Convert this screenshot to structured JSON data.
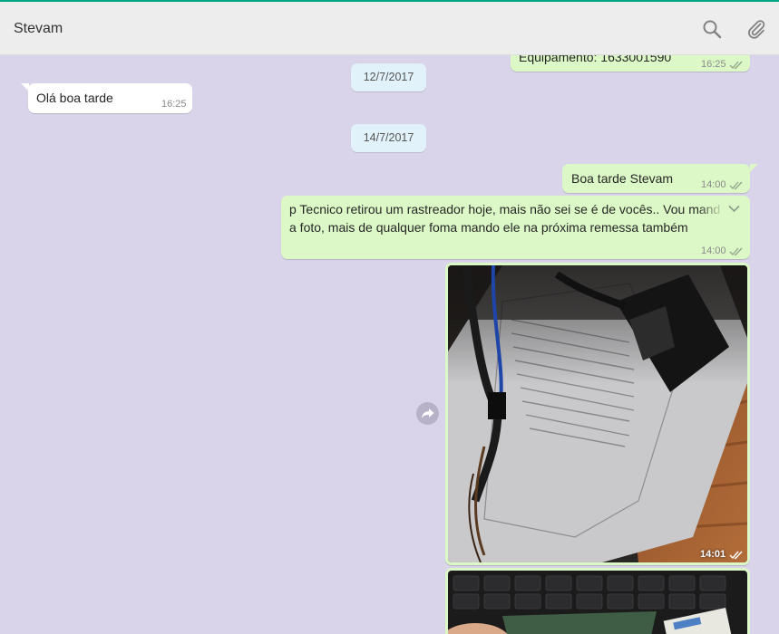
{
  "header": {
    "contact_name": "Stevam",
    "search_icon": "search-icon",
    "attach_icon": "paperclip-icon"
  },
  "colors": {
    "accent": "#00a884",
    "chat_bg": "#d9d4ea",
    "outgoing": "#dcf8c6",
    "incoming": "#ffffff",
    "date_chip": "#e1f2fb"
  },
  "messages": {
    "partial_top": {
      "text": "Equipamento: 1633001590",
      "time": "16:25"
    },
    "date_1": "12/7/2017",
    "incoming_1": {
      "text": "Olá boa tarde",
      "time": "16:25"
    },
    "date_2": "14/7/2017",
    "outgoing_1": {
      "text": "Boa tarde Stevam",
      "time": "14:00"
    },
    "outgoing_2": {
      "line1": "p Tecnico retirou um rastreador hoje, mais não sei se é de vocês.. Vou mand",
      "line2": "a foto, mais de qualquer foma mando ele na próxima remessa também",
      "time": "14:00"
    },
    "photo_1": {
      "time": "14:01"
    }
  }
}
